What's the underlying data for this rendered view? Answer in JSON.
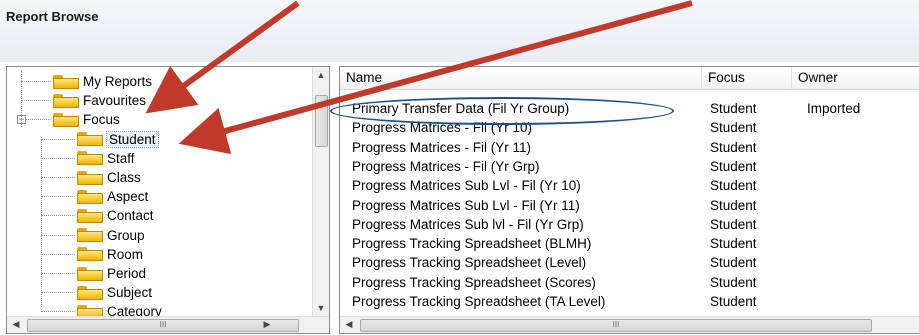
{
  "window": {
    "title": "Report Browse"
  },
  "tree": {
    "items": [
      {
        "label": "My Reports",
        "level": 0,
        "expander": ""
      },
      {
        "label": "Favourites",
        "level": 0,
        "expander": ""
      },
      {
        "label": "Focus",
        "level": 0,
        "expander": "−"
      },
      {
        "label": "Student",
        "level": 1,
        "selected": true
      },
      {
        "label": "Staff",
        "level": 1
      },
      {
        "label": "Class",
        "level": 1
      },
      {
        "label": "Aspect",
        "level": 1
      },
      {
        "label": "Contact",
        "level": 1
      },
      {
        "label": "Group",
        "level": 1
      },
      {
        "label": "Room",
        "level": 1
      },
      {
        "label": "Period",
        "level": 1
      },
      {
        "label": "Subject",
        "level": 1
      },
      {
        "label": "Category",
        "level": 1
      }
    ],
    "scroll_up": "▲",
    "scroll_down": "▼",
    "scroll_left": "◀",
    "scroll_right": "▶",
    "thumb_grip": "III"
  },
  "list": {
    "columns": [
      "Name",
      "Focus",
      "Owner"
    ],
    "rows": [
      [
        "Primary Transfer Data (Fil Yr Group)",
        "Student",
        "Imported"
      ],
      [
        "Progress Matrices - Fil (Yr 10)",
        "Student",
        ""
      ],
      [
        "Progress Matrices - Fil (Yr 11)",
        "Student",
        ""
      ],
      [
        "Progress Matrices - Fil (Yr Grp)",
        "Student",
        ""
      ],
      [
        "Progress Matrices Sub Lvl - Fil (Yr 10)",
        "Student",
        ""
      ],
      [
        "Progress Matrices Sub Lvl - Fil (Yr 11)",
        "Student",
        ""
      ],
      [
        "Progress Matrices Sub lvl - Fil (Yr Grp)",
        "Student",
        ""
      ],
      [
        "Progress Tracking Spreadsheet (BLMH)",
        "Student",
        ""
      ],
      [
        "Progress Tracking Spreadsheet (Level)",
        "Student",
        ""
      ],
      [
        "Progress Tracking Spreadsheet (Scores)",
        "Student",
        ""
      ],
      [
        "Progress Tracking Spreadsheet (TA Level)",
        "Student",
        ""
      ]
    ],
    "scroll_left": "◀",
    "thumb_grip": "III"
  },
  "colors": {
    "annotation_arrow": "#c0392b",
    "highlight_ellipse": "#1f4e8c",
    "folder": "#f0b400"
  }
}
